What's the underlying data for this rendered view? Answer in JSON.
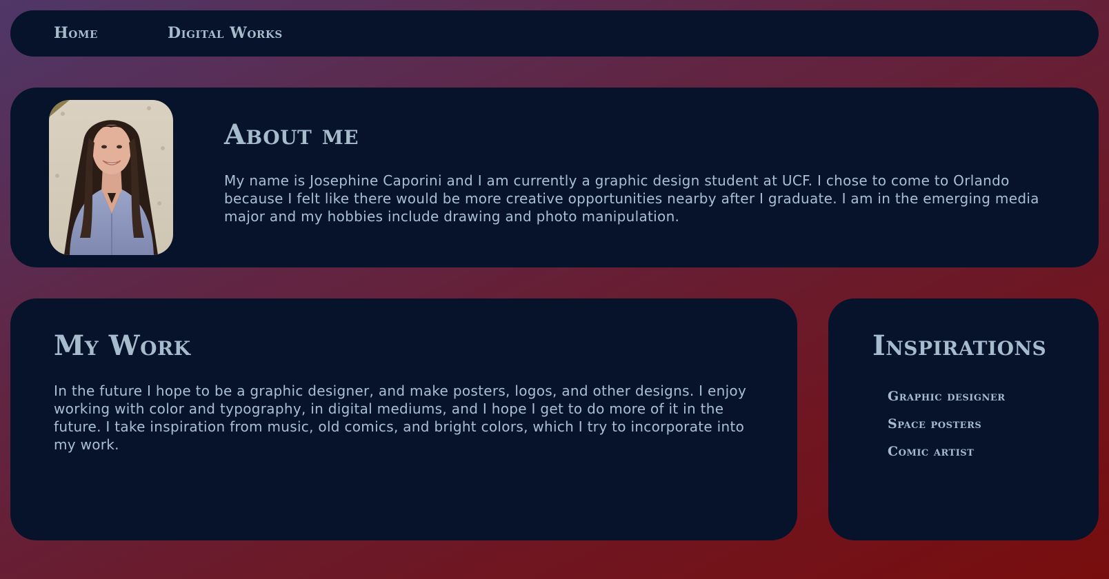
{
  "nav": {
    "home_label": "Home",
    "digital_works_label": "Digital Works"
  },
  "about": {
    "title": "About me",
    "text": "My name is Josephine Caporini and I am currently a graphic design student at UCF. I chose to come to Orlando because I felt like there would be more creative opportunities nearby after I graduate. I am in the emerging media major and my hobbies include drawing and photo manipulation."
  },
  "work": {
    "title": "My Work",
    "text": "In the future I hope to be a graphic designer, and make posters, logos, and other designs. I enjoy working with color and typography, in digital mediums, and I hope I get to do more of it in the future. I take inspiration from music, old comics, and bright colors, which I try to incorporate into my work."
  },
  "inspirations": {
    "title": "Inspirations",
    "items": [
      "Graphic designer",
      "Space posters",
      "Comic artist"
    ]
  },
  "colors": {
    "panel": "#06132b",
    "heading": "#a6bccc",
    "body_text": "#aac0d0",
    "gradient_top": "#4f3768",
    "gradient_bottom": "#780d0d"
  }
}
